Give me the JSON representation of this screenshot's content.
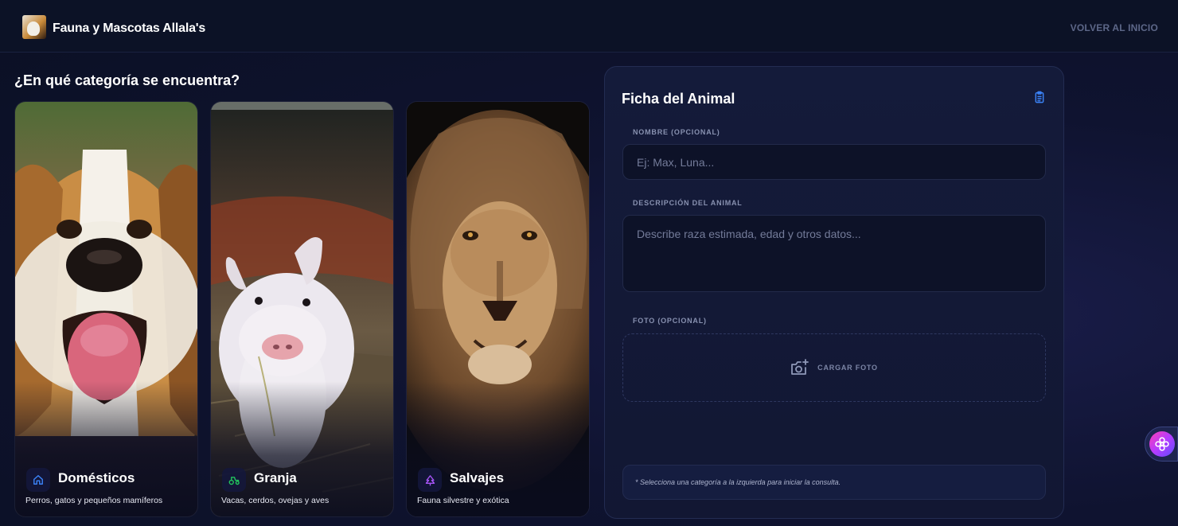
{
  "header": {
    "brand": "Fauna y Mascotas Allala's",
    "back_link": "VOLVER AL INICIO"
  },
  "category_section": {
    "question": "¿En qué categoría se encuentra?",
    "cards": [
      {
        "title": "Domésticos",
        "subtitle": "Perros, gatos y pequeños mamíferos",
        "icon": "house-icon"
      },
      {
        "title": "Granja",
        "subtitle": "Vacas, cerdos, ovejas y aves",
        "icon": "tractor-icon"
      },
      {
        "title": "Salvajes",
        "subtitle": "Fauna silvestre y exótica",
        "icon": "tree-icon"
      }
    ]
  },
  "form": {
    "title": "Ficha del Animal",
    "name_label": "NOMBRE (OPCIONAL)",
    "name_placeholder": "Ej: Max, Luna...",
    "description_label": "DESCRIPCIÓN DEL ANIMAL",
    "description_placeholder": "Describe raza estimada, edad y otros datos...",
    "photo_label": "FOTO (OPCIONAL)",
    "upload_label": "CARGAR FOTO",
    "notice": "* Selecciona una categoría a la izquierda para iniciar la consulta."
  },
  "colors": {
    "background": "#0b1024",
    "panel": "#141b3a",
    "accent_blue": "#3b82f6",
    "accent_green": "#22c55e",
    "accent_purple": "#a855f7"
  }
}
